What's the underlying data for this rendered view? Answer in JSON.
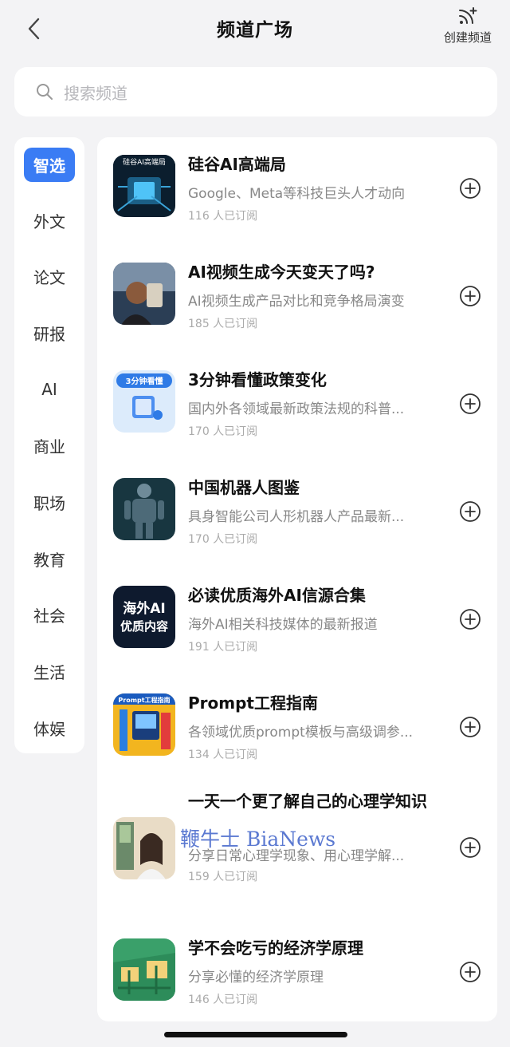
{
  "header": {
    "title": "频道广场",
    "create_label": "创建频道"
  },
  "search": {
    "placeholder": "搜索频道"
  },
  "sidebar": {
    "items": [
      {
        "label": "智选",
        "active": true
      },
      {
        "label": "外文"
      },
      {
        "label": "论文"
      },
      {
        "label": "研报"
      },
      {
        "label": "AI"
      },
      {
        "label": "商业"
      },
      {
        "label": "职场"
      },
      {
        "label": "教育"
      },
      {
        "label": "社会"
      },
      {
        "label": "生活"
      },
      {
        "label": "体娱"
      }
    ]
  },
  "channels": [
    {
      "title": "硅谷AI高端局",
      "desc": "Google、Meta等科技巨头人才动向",
      "subs": "116 人已订阅",
      "thumb_text": "硅谷AI高端局"
    },
    {
      "title": "AI视频生成今天变天了吗?",
      "desc": "AI视频生成产品对比和竞争格局演变",
      "subs": "185 人已订阅"
    },
    {
      "title": "3分钟看懂政策变化",
      "desc": "国内外各领域最新政策法规的科普...",
      "subs": "170 人已订阅",
      "thumb_text": "3分钟看懂"
    },
    {
      "title": "中国机器人图鉴",
      "desc": "具身智能公司人形机器人产品最新...",
      "subs": "170 人已订阅"
    },
    {
      "title": "必读优质海外AI信源合集",
      "desc": "海外AI相关科技媒体的最新报道",
      "subs": "191 人已订阅",
      "thumb_text_1": "海外AI",
      "thumb_text_2": "优质内容"
    },
    {
      "title": "Prompt工程指南",
      "desc": "各领域优质prompt模板与高级调参...",
      "subs": "134 人已订阅",
      "thumb_text": "Prompt工程指南"
    },
    {
      "title": "一天一个更了解自己的心理学知识",
      "desc": "分享日常心理学现象、用心理学解...",
      "subs": "159 人已订阅"
    },
    {
      "title": "学不会吃亏的经济学原理",
      "desc": "分享必懂的经济学原理",
      "subs": "146 人已订阅"
    }
  ],
  "watermark": "鞭牛士 BiaNews",
  "colors": {
    "accent": "#3a7cf4",
    "background": "#f3f3f5"
  }
}
